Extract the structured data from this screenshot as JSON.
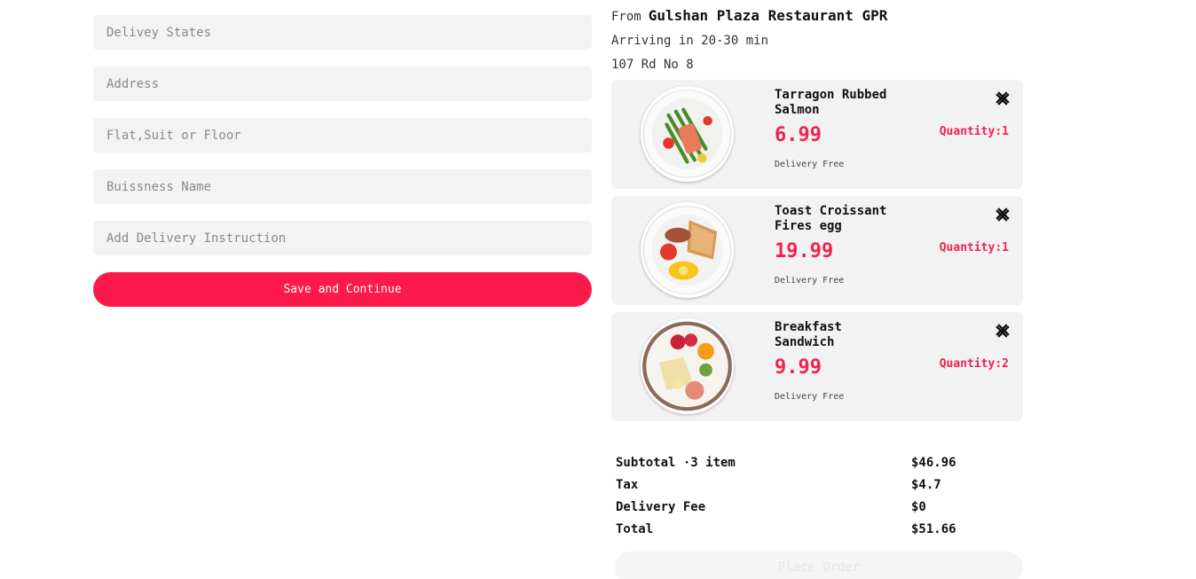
{
  "form": {
    "fields": [
      {
        "placeholder": "Delivey States"
      },
      {
        "placeholder": "Address"
      },
      {
        "placeholder": "Flat,Suit or Floor"
      },
      {
        "placeholder": "Buissness Name"
      },
      {
        "placeholder": "Add Delivery Instruction"
      }
    ],
    "save_label": "Save and Continue"
  },
  "summary": {
    "from_label": "From",
    "restaurant": "Gulshan Plaza Restaurant GPR",
    "arriving": "Arriving in 20-30 min",
    "address": "107 Rd No 8",
    "items": [
      {
        "name": "Tarragon Rubbed Salmon",
        "price": "6.99",
        "delivery": "Delivery Free",
        "quantity": "Quantity:1",
        "image_icon": "salmon-dish-icon"
      },
      {
        "name": "Toast Croissant Fires egg",
        "price": "19.99",
        "delivery": "Delivery Free",
        "quantity": "Quantity:1",
        "image_icon": "toast-breakfast-icon"
      },
      {
        "name": "Breakfast Sandwich",
        "price": "9.99",
        "delivery": "Delivery Free",
        "quantity": "Quantity:2",
        "image_icon": "sandwich-dish-icon"
      }
    ],
    "totals": [
      {
        "label": "Subtotal ·3 item",
        "value": "$46.96"
      },
      {
        "label": "Tax",
        "value": "$4.7"
      },
      {
        "label": "Delivery Fee",
        "value": "$0"
      },
      {
        "label": "Total",
        "value": "$51.66"
      }
    ],
    "place_order_label": "Place Order"
  },
  "colors": {
    "accent": "#fc1a4b",
    "price": "#f0234f",
    "field_bg": "#f3f3f3",
    "card_bg": "#f2f2f2"
  }
}
